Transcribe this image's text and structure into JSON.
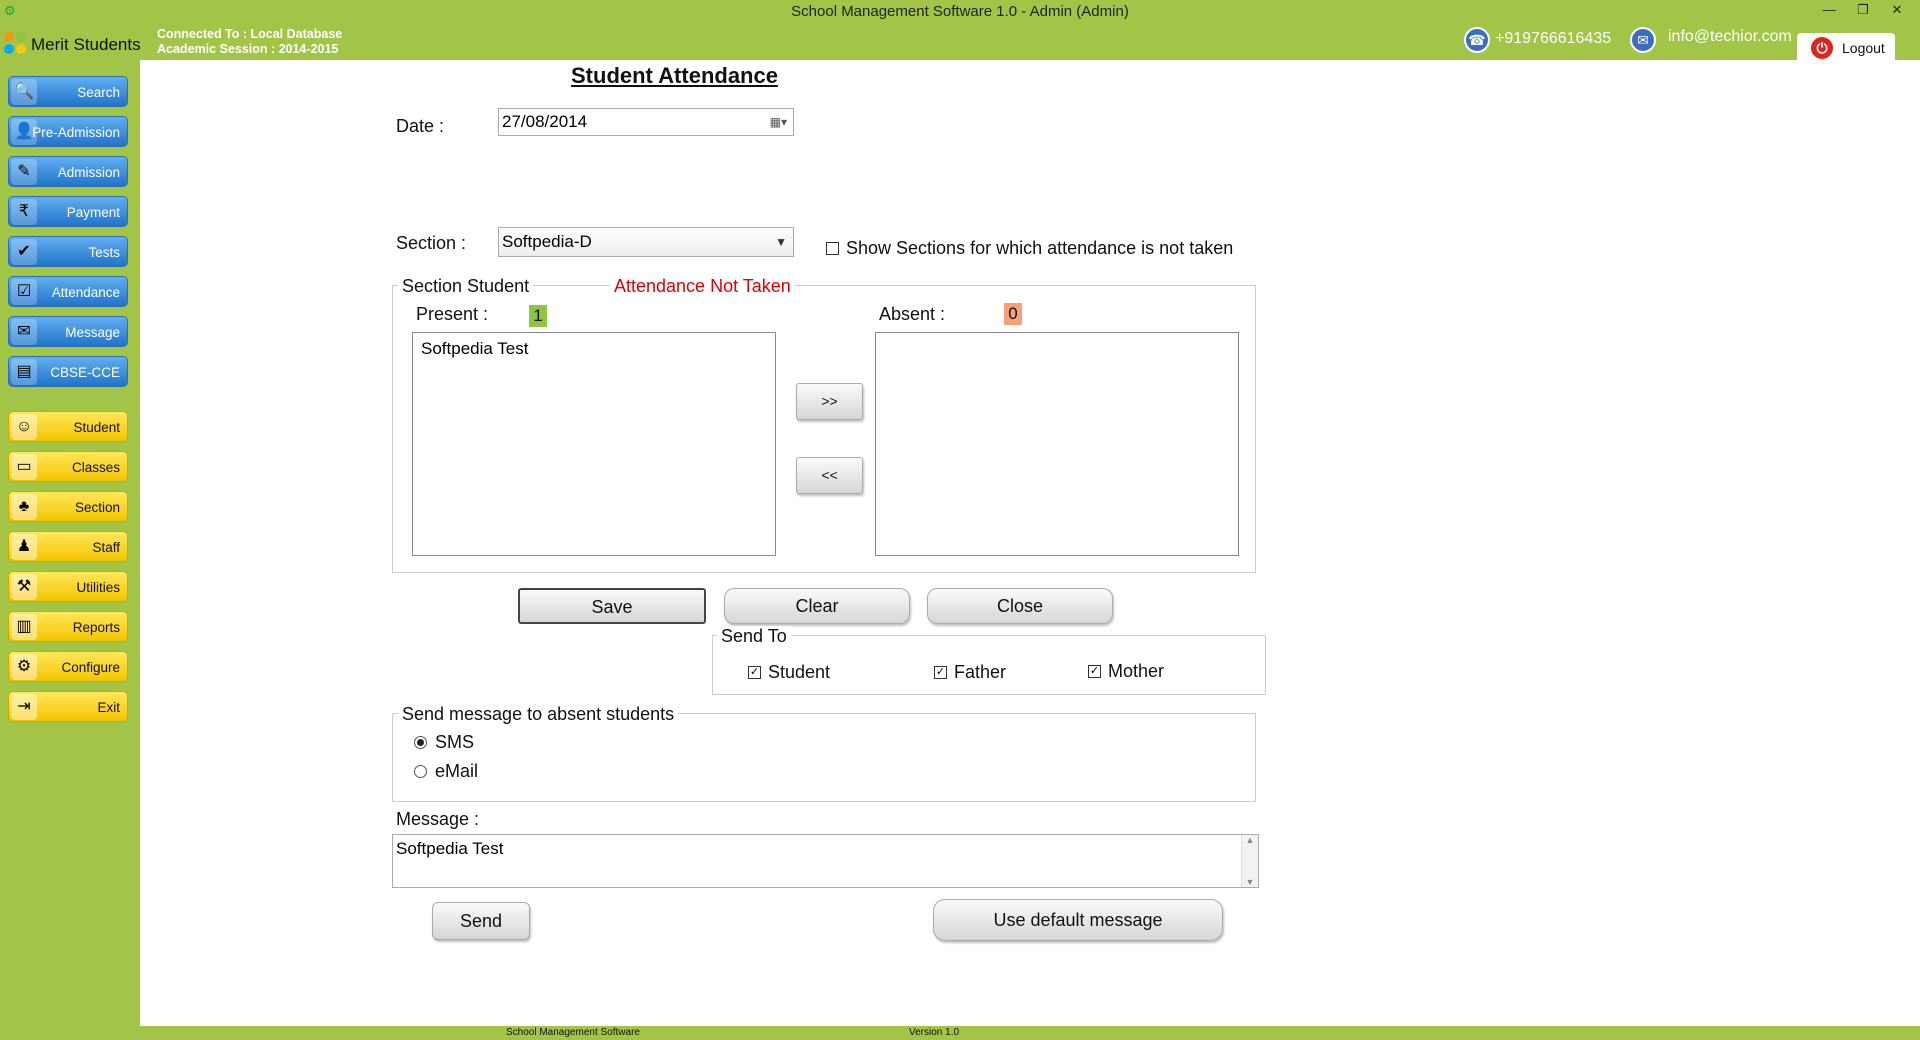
{
  "window": {
    "title": "School Management Software 1.0  -  Admin (Admin)",
    "minimize": "—",
    "restore": "❐",
    "close": "✕"
  },
  "header": {
    "brand": "Merit Students",
    "connected": "Connected To : Local Database",
    "session": "Academic Session : 2014-2015",
    "phone": "+919766616435",
    "email": "info@techior.com",
    "logout": "Logout"
  },
  "sidebar": {
    "primary": [
      {
        "label": "Search",
        "icon": "search-icon"
      },
      {
        "label": "Pre-Admission",
        "icon": "pre-admission-icon"
      },
      {
        "label": "Admission",
        "icon": "admission-icon"
      },
      {
        "label": "Payment",
        "icon": "payment-icon"
      },
      {
        "label": "Tests",
        "icon": "tests-icon"
      },
      {
        "label": "Attendance",
        "icon": "attendance-icon"
      },
      {
        "label": "Message",
        "icon": "message-icon"
      },
      {
        "label": "CBSE-CCE",
        "icon": "cbse-icon"
      }
    ],
    "secondary": [
      {
        "label": "Student",
        "icon": "student-icon"
      },
      {
        "label": "Classes",
        "icon": "classes-icon"
      },
      {
        "label": "Section",
        "icon": "section-icon"
      },
      {
        "label": "Staff",
        "icon": "staff-icon"
      },
      {
        "label": "Utilities",
        "icon": "utilities-icon"
      },
      {
        "label": "Reports",
        "icon": "reports-icon"
      },
      {
        "label": "Configure",
        "icon": "configure-icon"
      },
      {
        "label": "Exit",
        "icon": "exit-icon"
      }
    ]
  },
  "form": {
    "title": "Student Attendance",
    "date_label": "Date :",
    "date_value": "27/08/2014",
    "section_label": "Section :",
    "section_value": "Softpedia-D",
    "show_sections_label": "Show Sections for which attendance is not taken",
    "show_sections_checked": false,
    "section_student_legend": "Section Student",
    "attendance_status": "Attendance Not Taken",
    "present_label": "Present :",
    "present_count": "1",
    "absent_label": "Absent :",
    "absent_count": "0",
    "present_list": [
      "Softpedia  Test"
    ],
    "absent_list": [],
    "move_right": ">>",
    "move_left": "<<",
    "save": "Save",
    "clear": "Clear",
    "close": "Close",
    "send_to_legend": "Send To",
    "send_to": [
      {
        "label": "Student",
        "checked": true
      },
      {
        "label": "Father",
        "checked": true
      },
      {
        "label": "Mother",
        "checked": true
      }
    ],
    "send_message_legend": "Send message to absent students",
    "sms": "SMS",
    "email_opt": "eMail",
    "message_label": "Message :",
    "message_value": "Softpedia Test",
    "send": "Send",
    "use_default": "Use default message"
  },
  "status": {
    "left": "School Management Software",
    "right": "Version 1.0"
  },
  "colors": {
    "chrome_green": "#a2c548",
    "present_badge": "#8dc63f",
    "absent_badge": "#f4a07a",
    "status_red": "#e00000"
  }
}
